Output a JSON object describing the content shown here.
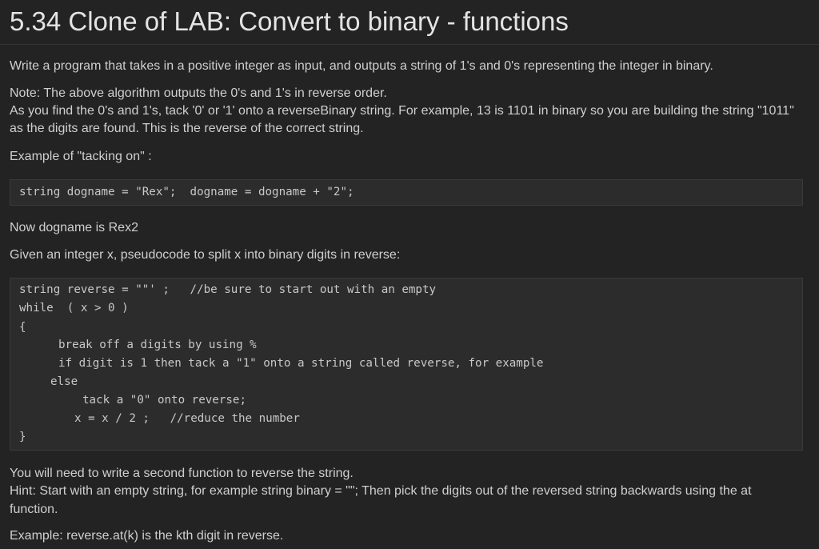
{
  "title": "5.34 Clone of LAB: Convert to binary - functions",
  "paragraphs": {
    "intro": "Write a program that takes in a positive integer as input, and outputs a string of 1's and 0's representing the integer in binary.",
    "note1": "Note: The above algorithm outputs the 0's and 1's in reverse order.",
    "note2": "As you find the 0's and 1's, tack '0' or '1' onto a reverseBinary string. For example, 13 is 1101 in binary so you are building the string \"1011\"",
    "note3": "as the digits are found. This is the reverse of the correct string.",
    "example_heading": "Example of \"tacking on\" :",
    "now_dogname": "Now dogname is Rex2",
    "given": "Given an integer x, pseudocode to split x into binary digits in reverse:",
    "need1": "You will need to write a second function to reverse the string.",
    "hint1": "Hint: Start with an empty string, for example string binary = \"\"; Then pick the digits out of the reversed string backwards using the at",
    "hint2": "function.",
    "example_reverse": "Example: reverse.at(k) is the kth digit in reverse."
  },
  "code1": {
    "line1": "string dogname = \"Rex\";  dogname = dogname + \"2\";"
  },
  "code2": {
    "line1": "string reverse = \"\"' ;   //be sure to start out with an empty",
    "line2": "while  ( x > 0 )",
    "line3": "{",
    "line4": "break off a digits by using %",
    "line5": "if digit is 1 then tack a \"1\" onto a string called reverse, for example",
    "line6": "else",
    "line7": "tack a \"0\" onto reverse;",
    "line8": "x = x / 2 ;   //reduce the number",
    "line9": "}"
  }
}
